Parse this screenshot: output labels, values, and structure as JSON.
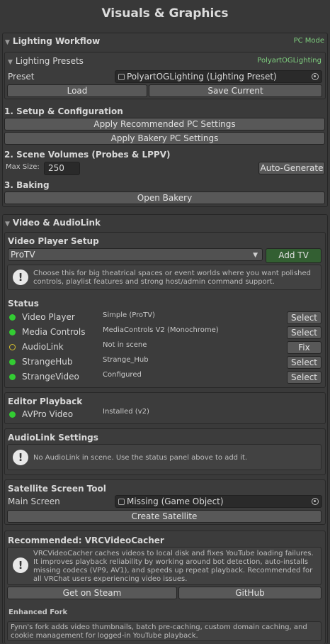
{
  "title": "Visuals & Graphics",
  "lighting": {
    "header": "Lighting Workflow",
    "mode": "PC Mode",
    "presets": {
      "header": "Lighting Presets",
      "preset_name_right": "PolyartOGLighting",
      "preset_label": "Preset",
      "preset_value": "PolyartOGLighting (Lighting Preset)",
      "load": "Load",
      "save": "Save Current"
    },
    "setup_header": "1. Setup & Configuration",
    "apply_pc": "Apply Recommended PC Settings",
    "apply_bakery": "Apply Bakery PC Settings",
    "volumes_header": "2. Scene Volumes (Probes & LPPV)",
    "max_size_label": "Max Size:",
    "max_size_value": "250",
    "auto_generate": "Auto-Generate",
    "baking_header": "3. Baking",
    "open_bakery": "Open Bakery"
  },
  "video": {
    "header": "Video & AudioLink",
    "player_setup": {
      "header": "Video Player Setup",
      "selected": "ProTV",
      "add_button": "Add TV",
      "help": "Choose this for big theatrical spaces or event worlds where you want polished controls, playlist features and strong host/admin command support."
    },
    "status": {
      "header": "Status",
      "rows": [
        {
          "label": "Video Player",
          "value": "Simple (ProTV)",
          "action": "Select",
          "ok": true
        },
        {
          "label": "Media Controls",
          "value": "MediaControls V2 (Monochrome)",
          "action": "Select",
          "ok": true
        },
        {
          "label": "AudioLink",
          "value": "Not in scene",
          "action": "Fix",
          "ok": false
        },
        {
          "label": "StrangeHub",
          "value": "Strange_Hub",
          "action": "Select",
          "ok": true
        },
        {
          "label": "StrangeVideo",
          "value": "Configured",
          "action": "Select",
          "ok": true
        }
      ]
    },
    "editor_playback": {
      "header": "Editor Playback",
      "label": "AVPro Video",
      "value": "Installed (v2)"
    },
    "audiolink": {
      "header": "AudioLink Settings",
      "help": "No AudioLink in scene. Use the status panel above to add it."
    },
    "satellite": {
      "header": "Satellite Screen Tool",
      "main_label": "Main Screen",
      "main_value": "Missing (Game Object)",
      "create": "Create Satellite"
    },
    "cacher": {
      "header": "Recommended: VRCVideoCacher",
      "help": "VRCVideoCacher caches videos to local disk and fixes YouTube loading failures. It improves playback reliability by working around bot detection, auto-installs missing codecs (VP9, AV1), and speeds up repeat playback. Recommended for all VRChat users experiencing video issues.",
      "steam": "Get on Steam",
      "github": "GitHub",
      "fork_header": "Enhanced Fork",
      "fork_text": "Fynn's fork adds video thumbnails, batch pre-caching, custom domain caching, and cookie management for logged-in YouTube playback."
    }
  },
  "colors": {
    "background": "#383838",
    "accent_green": "#7fd07f",
    "status_ok": "#33cc33",
    "status_warn": "#d6c02e",
    "add_button": "#335f32"
  }
}
